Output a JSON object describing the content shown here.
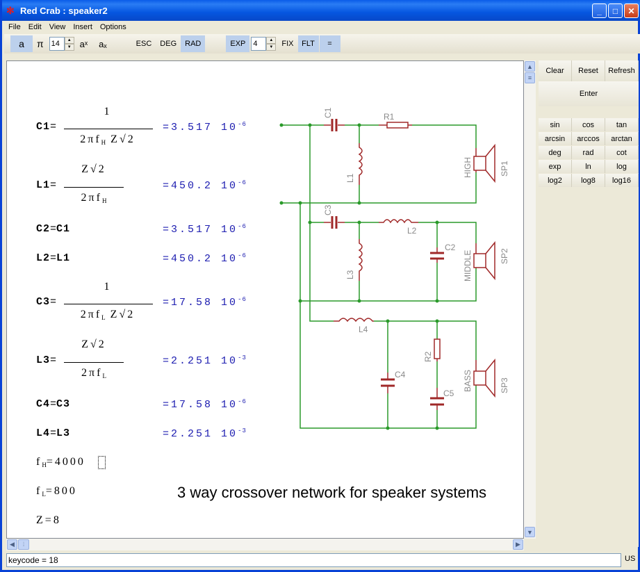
{
  "window": {
    "title": "Red Crab : speaker2",
    "minimize": "_",
    "maximize": "□",
    "close": "✕",
    "logo_icon": "crab-icon"
  },
  "menu": [
    "File",
    "Edit",
    "View",
    "Insert",
    "Options"
  ],
  "toolbar": {
    "a": "a",
    "pi": "π",
    "precision": "14",
    "power": "aˣ",
    "subscript": "aₓ",
    "esc": "ESC",
    "deg": "DEG",
    "rad": "RAD",
    "exp": "EXP",
    "exp_digits": "4",
    "fix": "FIX",
    "flt": "FLT",
    "equals": "="
  },
  "right_panel": {
    "clear": "Clear",
    "reset": "Reset",
    "refresh": "Refresh",
    "enter": "Enter",
    "functions": [
      [
        "sin",
        "cos",
        "tan"
      ],
      [
        "arcsin",
        "arccos",
        "arctan"
      ],
      [
        "deg",
        "rad",
        "cot"
      ],
      [
        "exp",
        "ln",
        "log"
      ],
      [
        "log2",
        "log8",
        "log16"
      ]
    ]
  },
  "equations": {
    "c1": {
      "lhs": "C1",
      "num": "1",
      "den": "2πf",
      "den_sub": "H",
      "den_tail": "Z√2",
      "result": "3.517",
      "exp_base": "10",
      "exp": "-6"
    },
    "l1": {
      "lhs": "L1",
      "num": "Z√2",
      "den": "2πf",
      "den_sub": "H",
      "result": "450.2",
      "exp_base": "10",
      "exp": "-6"
    },
    "c2": {
      "lhs": "C2",
      "rhs": "C1",
      "result": "3.517",
      "exp_base": "10",
      "exp": "-6"
    },
    "l2": {
      "lhs": "L2",
      "rhs": "L1",
      "result": "450.2",
      "exp_base": "10",
      "exp": "-6"
    },
    "c3": {
      "lhs": "C3",
      "num": "1",
      "den": "2πf",
      "den_sub": "L",
      "den_tail": "Z√2",
      "result": "17.58",
      "exp_base": "10",
      "exp": "-6"
    },
    "l3": {
      "lhs": "L3",
      "num": "Z√2",
      "den": "2πf",
      "den_sub": "L",
      "result": "2.251",
      "exp_base": "10",
      "exp": "-3"
    },
    "c4": {
      "lhs": "C4",
      "rhs": "C3",
      "result": "17.58",
      "exp_base": "10",
      "exp": "-6"
    },
    "l4": {
      "lhs": "L4",
      "rhs": "L3",
      "result": "2.251",
      "exp_base": "10",
      "exp": "-3"
    }
  },
  "variables": {
    "fh": {
      "name": "f",
      "sub": "H",
      "value": "4000"
    },
    "fl": {
      "name": "f",
      "sub": "L",
      "value": "800"
    },
    "z": {
      "name": "Z",
      "value": "8"
    }
  },
  "schematic": {
    "labels": {
      "c1": "C1",
      "r1": "R1",
      "l1": "L1",
      "high": "HIGH",
      "sp1": "SP1",
      "c3": "C3",
      "l2": "L2",
      "c2": "C2",
      "l3": "L3",
      "middle": "MIDDLE",
      "sp2": "SP2",
      "l4": "L4",
      "r2": "R2",
      "c4": "C4",
      "c5": "C5",
      "bass": "BASS",
      "sp3": "SP3"
    },
    "wire_color": "#2a9a2a",
    "part_color": "#a02828",
    "label_color": "#8a8a8a"
  },
  "caption": "3 way crossover network for speaker systems",
  "status": {
    "text": "keycode = 18",
    "locale": "US"
  }
}
